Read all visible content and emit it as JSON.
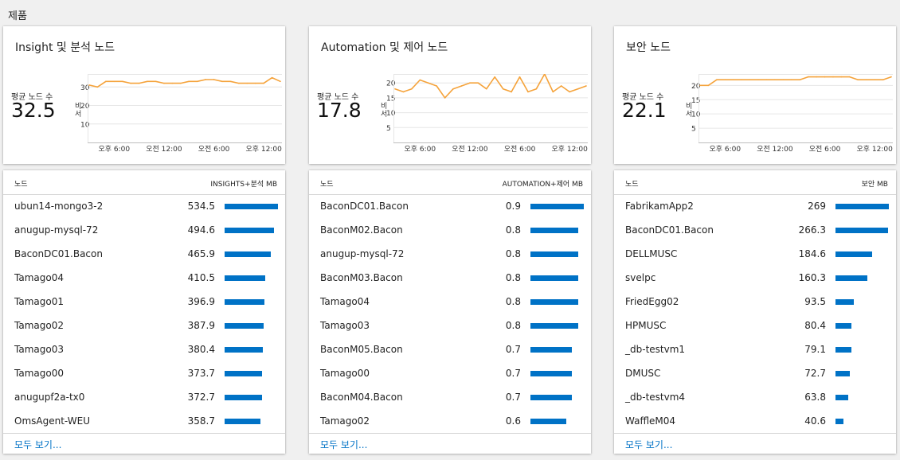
{
  "section_title": "제품",
  "colors": {
    "accent": "#0072c6",
    "line": "#f5a33b"
  },
  "panels": [
    {
      "title": "Insight 및 분석 노드",
      "avg_label": "평균 노드 수",
      "avg_value": "32.5",
      "y_axis_label": "비 서",
      "col_node": "노드",
      "col_metric": "INSIGHTS+분석 MB",
      "see_all": "모두 보기...",
      "rows": [
        {
          "name": "ubun14-mongo3-2",
          "value": "534.5"
        },
        {
          "name": "anugup-mysql-72",
          "value": "494.6"
        },
        {
          "name": "BaconDC01.Bacon",
          "value": "465.9"
        },
        {
          "name": "Tamago04",
          "value": "410.5"
        },
        {
          "name": "Tamago01",
          "value": "396.9"
        },
        {
          "name": "Tamago02",
          "value": "387.9"
        },
        {
          "name": "Tamago03",
          "value": "380.4"
        },
        {
          "name": "Tamago00",
          "value": "373.7"
        },
        {
          "name": "anugupf2a-tx0",
          "value": "372.7"
        },
        {
          "name": "OmsAgent-WEU",
          "value": "358.7"
        }
      ]
    },
    {
      "title": "Automation 및 제어 노드",
      "avg_label": "평균 노드 수",
      "avg_value": "17.8",
      "y_axis_label": "비 서",
      "col_node": "노드",
      "col_metric": "AUTOMATION+제어 MB",
      "see_all": "모두 보기...",
      "rows": [
        {
          "name": "BaconDC01.Bacon",
          "value": "0.9"
        },
        {
          "name": "BaconM02.Bacon",
          "value": "0.8"
        },
        {
          "name": "anugup-mysql-72",
          "value": "0.8"
        },
        {
          "name": "BaconM03.Bacon",
          "value": "0.8"
        },
        {
          "name": "Tamago04",
          "value": "0.8"
        },
        {
          "name": "Tamago03",
          "value": "0.8"
        },
        {
          "name": "BaconM05.Bacon",
          "value": "0.7"
        },
        {
          "name": "Tamago00",
          "value": "0.7"
        },
        {
          "name": "BaconM04.Bacon",
          "value": "0.7"
        },
        {
          "name": "Tamago02",
          "value": "0.6"
        }
      ]
    },
    {
      "title": "보안 노드",
      "avg_label": "평균 노드 수",
      "avg_value": "22.1",
      "y_axis_label": "비 서",
      "col_node": "노드",
      "col_metric": "보안 MB",
      "see_all": "모두 보기...",
      "rows": [
        {
          "name": "FabrikamApp2",
          "value": "269"
        },
        {
          "name": "BaconDC01.Bacon",
          "value": "266.3"
        },
        {
          "name": "DELLMUSC",
          "value": "184.6"
        },
        {
          "name": "svelpc",
          "value": "160.3"
        },
        {
          "name": "FriedEgg02",
          "value": "93.5"
        },
        {
          "name": "HPMUSC",
          "value": "80.4"
        },
        {
          "name": "_db-testvm1",
          "value": "79.1"
        },
        {
          "name": "DMUSC",
          "value": "72.7"
        },
        {
          "name": "_db-testvm4",
          "value": "63.8"
        },
        {
          "name": "WaffleM04",
          "value": "40.6"
        }
      ]
    }
  ],
  "chart_data": [
    {
      "type": "line",
      "xlabel": "",
      "ylabel": "",
      "x_ticks": [
        "오후 6:00",
        "오전 12:00",
        "오전 6:00",
        "오후 12:00"
      ],
      "x_tick_index": [
        3,
        9,
        15,
        21
      ],
      "y_ticks": [
        10,
        20,
        30
      ],
      "ylim": [
        0,
        37
      ],
      "grid": true,
      "values": [
        31,
        30,
        33,
        33,
        33,
        32,
        32,
        33,
        33,
        32,
        32,
        32,
        33,
        33,
        34,
        34,
        33,
        33,
        32,
        32,
        32,
        32,
        35,
        33
      ]
    },
    {
      "type": "line",
      "xlabel": "",
      "ylabel": "",
      "x_ticks": [
        "오후 6:00",
        "오전 12:00",
        "오전 6:00",
        "오후 12:00"
      ],
      "x_tick_index": [
        3,
        9,
        15,
        21
      ],
      "y_ticks": [
        5,
        10,
        15,
        20
      ],
      "ylim": [
        0,
        23
      ],
      "grid": true,
      "values": [
        18,
        17,
        18,
        21,
        20,
        19,
        15,
        18,
        19,
        20,
        20,
        18,
        22,
        18,
        17,
        22,
        17,
        18,
        23,
        17,
        19,
        17,
        18,
        19
      ]
    },
    {
      "type": "line",
      "xlabel": "",
      "ylabel": "",
      "x_ticks": [
        "오후 6:00",
        "오전 12:00",
        "오전 6:00",
        "오후 12:00"
      ],
      "x_tick_index": [
        3,
        9,
        15,
        21
      ],
      "y_ticks": [
        5,
        10,
        15,
        20
      ],
      "ylim": [
        0,
        24
      ],
      "grid": true,
      "values": [
        20,
        20,
        22,
        22,
        22,
        22,
        22,
        22,
        22,
        22,
        22,
        22,
        22,
        23,
        23,
        23,
        23,
        23,
        23,
        22,
        22,
        22,
        22,
        23
      ]
    }
  ]
}
